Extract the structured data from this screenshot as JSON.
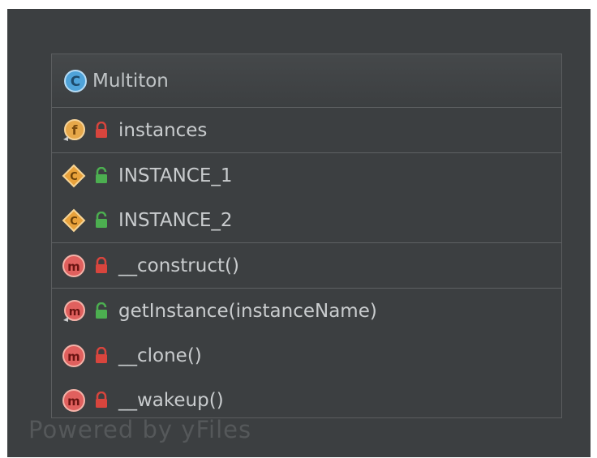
{
  "class_box": {
    "name": "Multiton",
    "kind_icon": "class-icon"
  },
  "sections": [
    {
      "rows": [
        {
          "label": "instances",
          "kind": "field-icon",
          "access": "private"
        }
      ]
    },
    {
      "rows": [
        {
          "label": "INSTANCE_1",
          "kind": "constant-icon",
          "access": "public"
        },
        {
          "label": "INSTANCE_2",
          "kind": "constant-icon",
          "access": "public"
        }
      ]
    },
    {
      "rows": [
        {
          "label": "__construct()",
          "kind": "method-icon",
          "access": "private"
        }
      ]
    },
    {
      "rows": [
        {
          "label": "getInstance(instanceName)",
          "kind": "static-method-icon",
          "access": "public"
        },
        {
          "label": "__clone()",
          "kind": "method-icon",
          "access": "private"
        },
        {
          "label": "__wakeup()",
          "kind": "method-icon",
          "access": "private"
        }
      ]
    }
  ],
  "watermark": "Powered by yFiles",
  "colors": {
    "background": "#3c3f41",
    "class_icon": "#4fa3d9",
    "field_icon": "#e7a84a",
    "constant_icon": "#e9a23b",
    "method_icon": "#e0605e",
    "lock_private": "#d8453d",
    "lock_public": "#4caf50"
  }
}
